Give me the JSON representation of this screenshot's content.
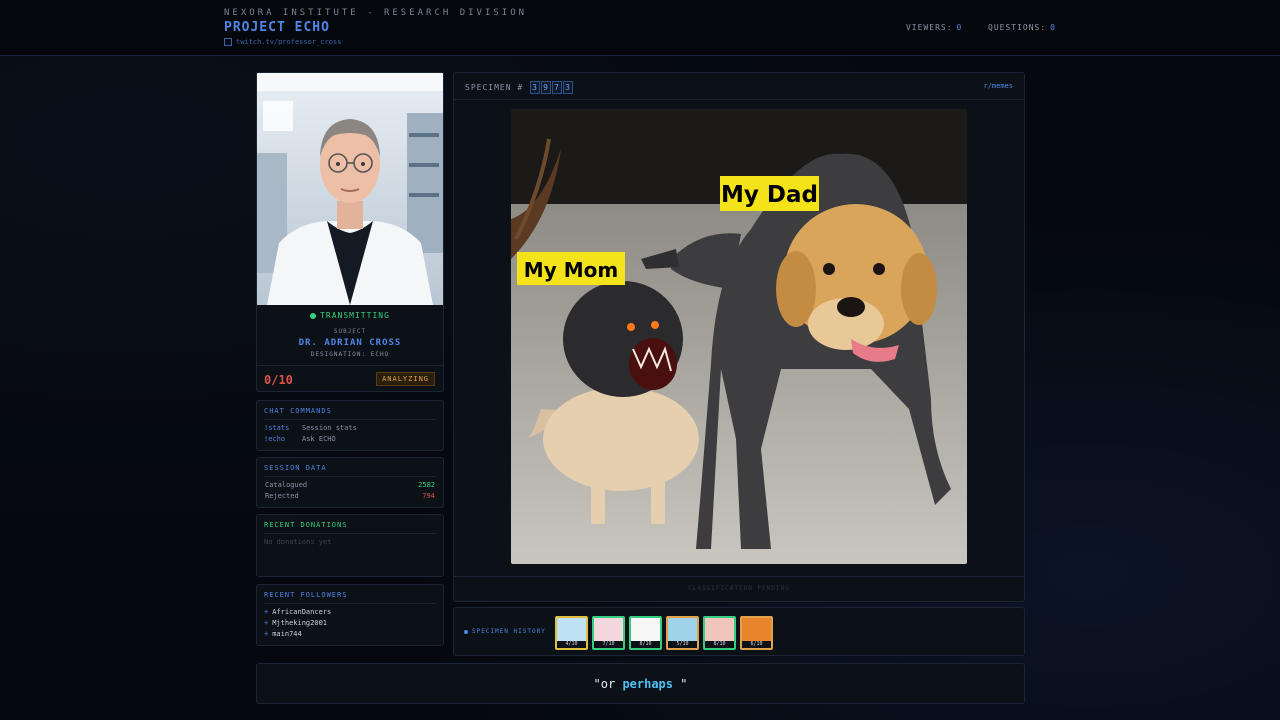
{
  "header": {
    "org": "NEXORA INSTITUTE - RESEARCH DIVISION",
    "project": "PROJECT ECHO",
    "link": "twitch.tv/professor_cross",
    "viewers_label": "VIEWERS:",
    "viewers_value": "0",
    "questions_label": "QUESTIONS:",
    "questions_value": "0"
  },
  "profile": {
    "status": "TRANSMITTING",
    "subject_label": "SUBJECT",
    "name": "DR. ADRIAN CROSS",
    "designation": "DESIGNATION: ECHO",
    "score": "0/10",
    "badge": "ANALYZING"
  },
  "commands": {
    "title": "CHAT COMMANDS",
    "items": [
      {
        "cmd": "!stats",
        "desc": "Session stats"
      },
      {
        "cmd": "!echo",
        "desc": "Ask ECHO"
      }
    ]
  },
  "session": {
    "title": "SESSION DATA",
    "rows": [
      {
        "label": "Catalogued",
        "value": "2582",
        "color": "#35d07f"
      },
      {
        "label": "Rejected",
        "value": "794",
        "color": "#e0504a"
      }
    ]
  },
  "donations": {
    "title": "RECENT DONATIONS",
    "empty": "No donations yet"
  },
  "followers": {
    "title": "RECENT FOLLOWERS",
    "items": [
      "AfricanDancers",
      "Mjtheking2001",
      "main744"
    ]
  },
  "specimen": {
    "label": "SPECIMEN #",
    "digits": [
      "3",
      "9",
      "7",
      "3"
    ],
    "source": "r/memes",
    "meme_text_1": "My Dad",
    "meme_text_2": "My Mom",
    "footer": "CLASSIFICATION PENDING"
  },
  "history": {
    "title": "SPECIMEN HISTORY",
    "items": [
      {
        "score": "4/10",
        "border": "#e0c040"
      },
      {
        "score": "7/10",
        "border": "#35d07f"
      },
      {
        "score": "8/10",
        "border": "#35d07f"
      },
      {
        "score": "5/10",
        "border": "#e0a24a"
      },
      {
        "score": "8/10",
        "border": "#35d07f"
      },
      {
        "score": "6/10",
        "border": "#e0a24a"
      }
    ]
  },
  "caption": {
    "before": "\"or ",
    "highlight": "perhaps",
    "after": " \""
  },
  "colors": {
    "accent": "#4f86e6",
    "success": "#35d07f",
    "danger": "#e0504a",
    "warning": "#e0a24a"
  }
}
